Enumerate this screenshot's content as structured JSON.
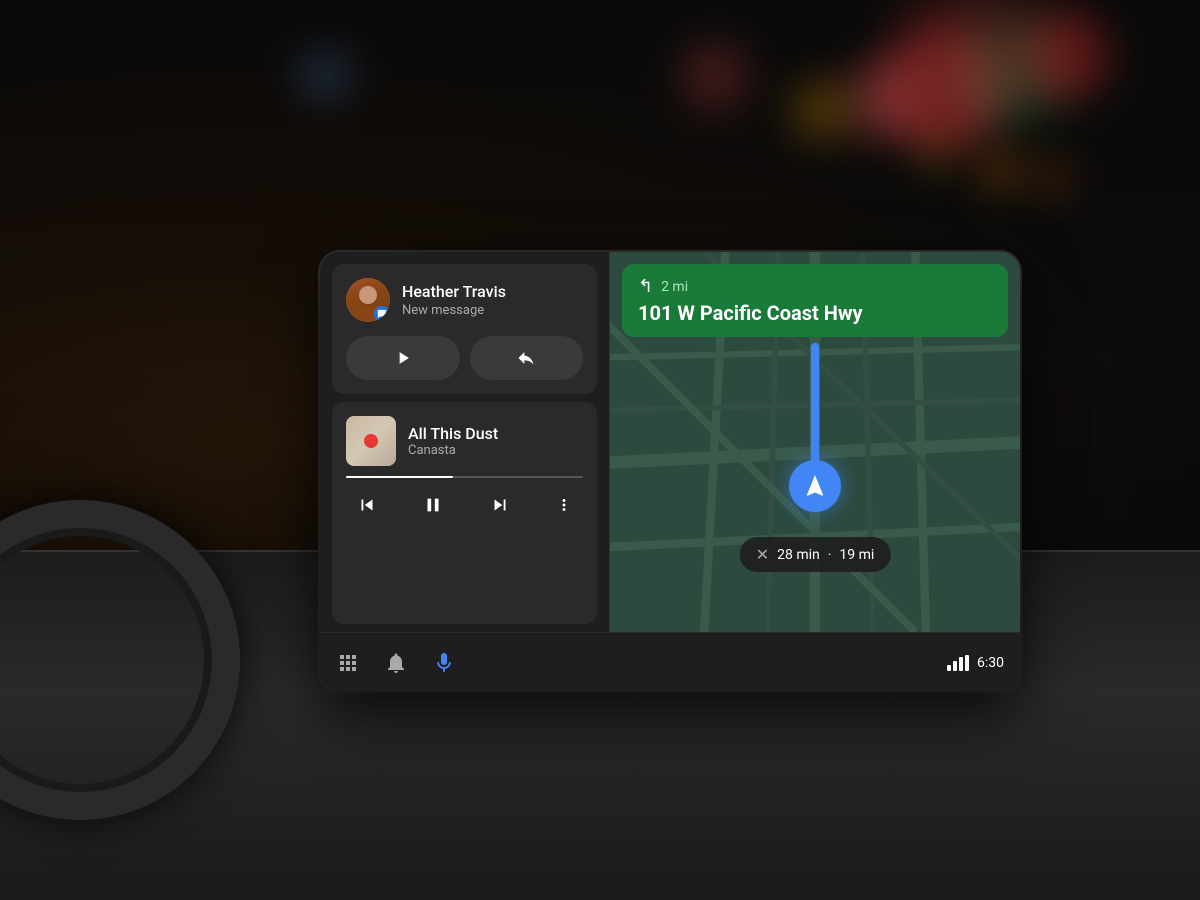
{
  "dashboard": {
    "background_color": "#1a1010"
  },
  "screen": {
    "left_panel": {
      "message_card": {
        "contact_name": "Heather Travis",
        "subtitle": "New message",
        "play_button_label": "Play",
        "reply_button_label": "Reply"
      },
      "music_card": {
        "track_title": "All This Dust",
        "artist": "Canasta",
        "progress_percent": 45
      },
      "bottom_nav": {
        "grid_icon": "grid-icon",
        "bell_icon": "bell-icon",
        "mic_icon": "mic-icon",
        "signal_label": "signal-icon",
        "time": "6:30"
      }
    },
    "right_panel": {
      "nav": {
        "distance": "2 mi",
        "street": "101 W Pacific Coast Hwy",
        "eta_time": "28 min",
        "eta_distance": "19 mi"
      }
    }
  }
}
